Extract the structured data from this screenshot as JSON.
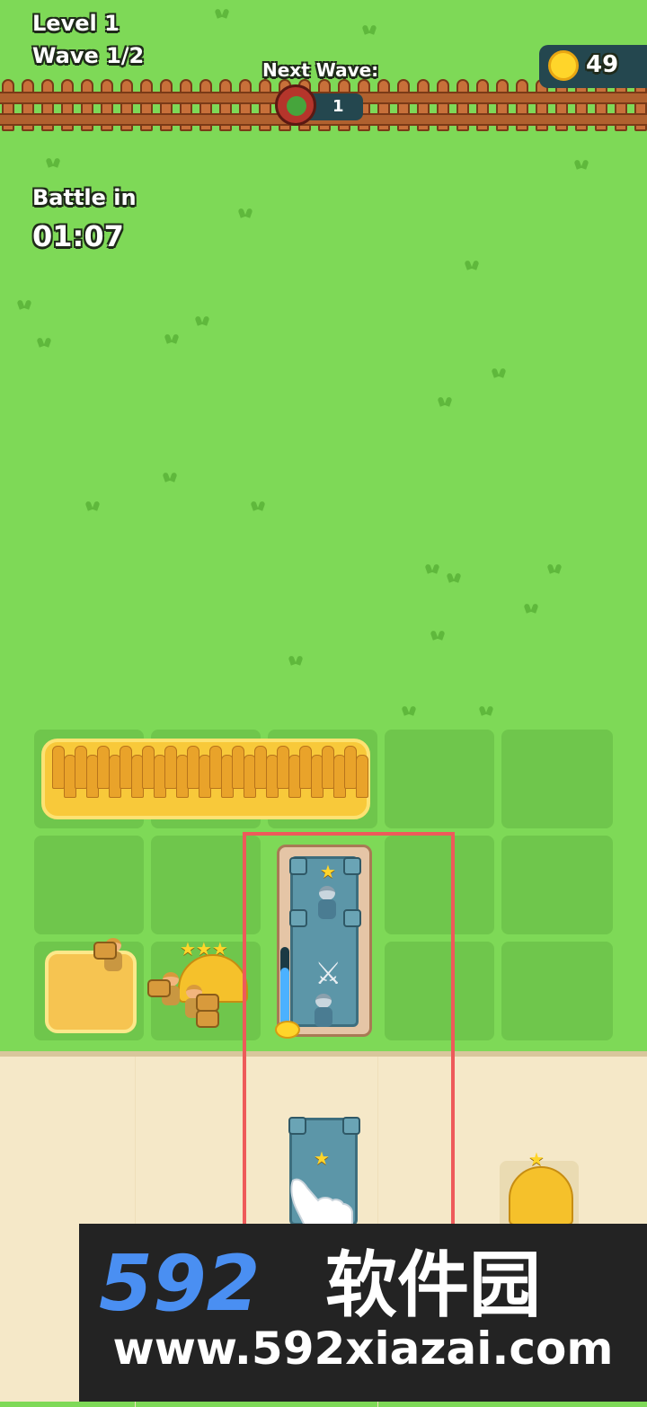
{
  "hud": {
    "level": "Level 1",
    "wave": "Wave 1/2",
    "next_wave_label": "Next Wave:",
    "next_wave_count": "1",
    "coins": "49",
    "battle_label": "Battle in",
    "battle_timer": "01:07"
  },
  "barracks": {
    "star_icon": "star-icon",
    "swords_icon": "crossed-swords-icon",
    "progress": 0.75
  },
  "farm_hut": {
    "stars": "★★★"
  },
  "shop": {
    "tower_star": "★",
    "hut_star": "★",
    "hand_icon": "pointing-hand-icon"
  },
  "colors": {
    "grass": "#7ed957",
    "tile": "#6fc64c",
    "road": "#f5e8c8",
    "highlight": "#ee5a5a",
    "coin": "#ffd52a",
    "hud_panel": "#24474f"
  },
  "watermark": {
    "title": "592软件园",
    "url": "www.592xiazai.com"
  }
}
